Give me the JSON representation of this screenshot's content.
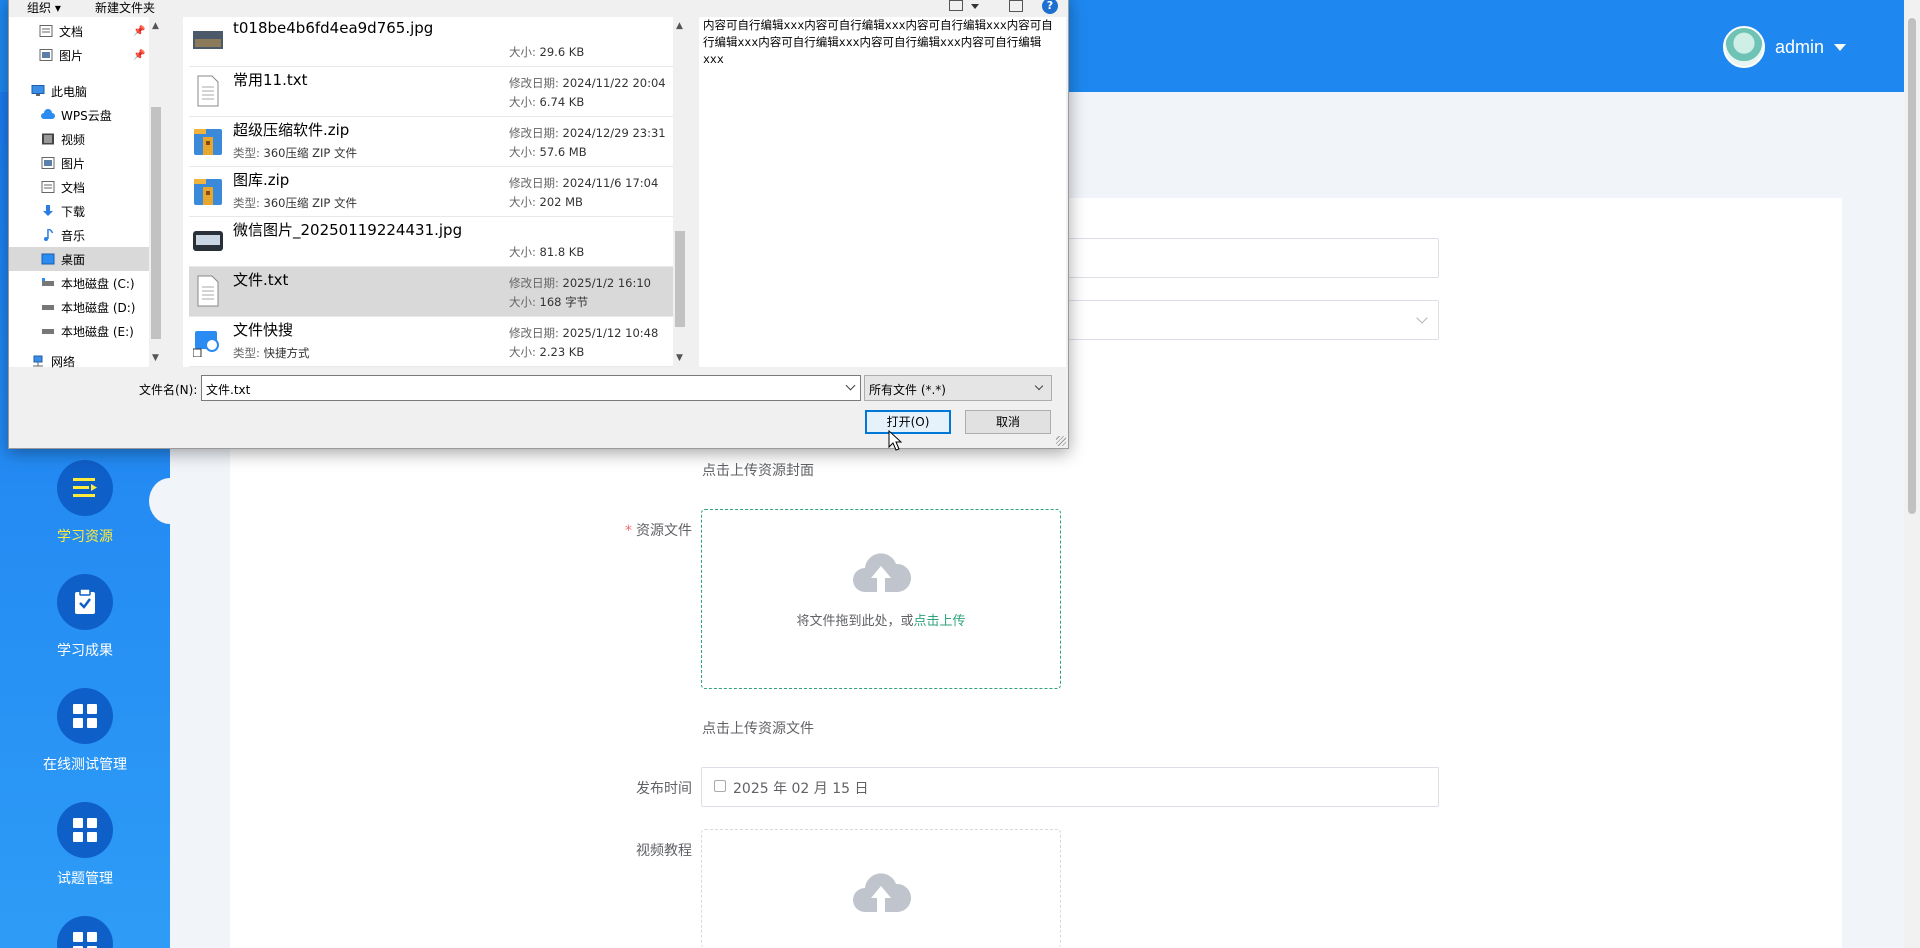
{
  "app": {
    "username": "admin",
    "nav": [
      {
        "label": "学习资源",
        "icon": "list-icon",
        "active": true
      },
      {
        "label": "学习成果",
        "icon": "clipboard-check-icon",
        "active": false
      },
      {
        "label": "在线测试管理",
        "icon": "grid-icon",
        "active": false
      },
      {
        "label": "试题管理",
        "icon": "grid-icon",
        "active": false
      }
    ],
    "form": {
      "cover_tip": "点击上传资源封面",
      "file_label": "资源文件",
      "upload_text": "将文件拖到此处，或",
      "upload_link": "点击上传",
      "file_tip": "点击上传资源文件",
      "publish_label": "发布时间",
      "publish_value": "2025 年 02 月 15 日",
      "video_label": "视频教程"
    }
  },
  "dialog": {
    "toolbar": {
      "organize": "组织 ▾",
      "new_folder": "新建文件夹"
    },
    "nav_tree": [
      {
        "label": "文档",
        "icon": "document-icon",
        "pinned": true,
        "indent": 1
      },
      {
        "label": "图片",
        "icon": "picture-icon",
        "pinned": true,
        "indent": 1
      },
      {
        "label": "此电脑",
        "icon": "computer-icon",
        "pinned": false,
        "indent": 0
      },
      {
        "label": "WPS云盘",
        "icon": "cloud-icon",
        "pinned": false,
        "indent": 1
      },
      {
        "label": "视频",
        "icon": "video-icon",
        "pinned": false,
        "indent": 1
      },
      {
        "label": "图片",
        "icon": "picture-icon",
        "pinned": false,
        "indent": 1
      },
      {
        "label": "文档",
        "icon": "document-icon",
        "pinned": false,
        "indent": 1
      },
      {
        "label": "下载",
        "icon": "download-icon",
        "pinned": false,
        "indent": 1
      },
      {
        "label": "音乐",
        "icon": "music-icon",
        "pinned": false,
        "indent": 1
      },
      {
        "label": "桌面",
        "icon": "desktop-icon",
        "pinned": false,
        "indent": 1,
        "selected": true
      },
      {
        "label": "本地磁盘 (C:)",
        "icon": "drive-icon",
        "pinned": false,
        "indent": 1
      },
      {
        "label": "本地磁盘 (D:)",
        "icon": "drive-icon",
        "pinned": false,
        "indent": 1
      },
      {
        "label": "本地磁盘 (E:)",
        "icon": "drive-icon",
        "pinned": false,
        "indent": 1
      },
      {
        "label": "网络",
        "icon": "network-icon",
        "pinned": false,
        "indent": 0
      }
    ],
    "files": [
      {
        "name": "t018be4b6fd4ea9d765.jpg",
        "type": "",
        "date": "",
        "size": "29.6 KB",
        "icon": "image-file-icon"
      },
      {
        "name": "常用11.txt",
        "type": "",
        "date": "2024/11/22 20:04",
        "size": "6.74 KB",
        "icon": "text-file-icon"
      },
      {
        "name": "超级压缩软件.zip",
        "type": "360压缩 ZIP 文件",
        "date": "2024/12/29 23:31",
        "size": "57.6 MB",
        "icon": "zip-file-icon"
      },
      {
        "name": "图库.zip",
        "type": "360压缩 ZIP 文件",
        "date": "2024/11/6 17:04",
        "size": "202 MB",
        "icon": "zip-file-icon"
      },
      {
        "name": "微信图片_20250119224431.jpg",
        "type": "",
        "date": "",
        "size": "81.8 KB",
        "icon": "image-file-icon"
      },
      {
        "name": "文件.txt",
        "type": "",
        "date": "2025/1/2 16:10",
        "size": "168 字节",
        "icon": "text-file-icon",
        "selected": true
      },
      {
        "name": "文件快搜",
        "type": "快捷方式",
        "date": "2025/1/12 10:48",
        "size": "2.23 KB",
        "icon": "shortcut-icon"
      }
    ],
    "labels": {
      "modified": "修改日期:",
      "size": "大小:",
      "type": "类型:"
    },
    "preview_text": "内容可自行编辑xxx内容可自行编辑xxx内容可自行编辑xxx内容可自行编辑xxx内容可自行编辑xxx内容可自行编辑xxx内容可自行编辑xxx",
    "filename_label": "文件名(N):",
    "filename_value": "文件.txt",
    "filetype_value": "所有文件 (*.*)",
    "open_label": "打开(O)",
    "cancel_label": "取消"
  }
}
